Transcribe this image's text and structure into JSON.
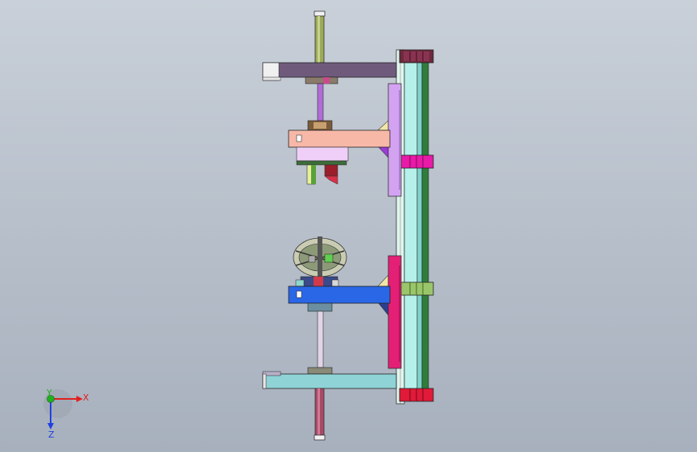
{
  "viewport": {
    "background_top": "#c9d0d9",
    "background_bottom": "#a7b0bd"
  },
  "triad": {
    "x_label": "X",
    "y_label": "Y",
    "z_label": "Z",
    "x_color": "#e02020",
    "y_color": "#20b020",
    "z_color": "#2040e0"
  },
  "model": {
    "parts": [
      "top-rod",
      "top-arm",
      "upper-spindle",
      "upper-arm",
      "upper-gripper",
      "rotary-table",
      "lower-arm",
      "lower-spindle",
      "bottom-arm",
      "bottom-rod",
      "main-column",
      "upper-slide-plate",
      "lower-slide-plate",
      "column-clamps"
    ],
    "colors": {
      "top_arm": "#6f5a7c",
      "upper_arm": "#f7b8a8",
      "lower_arm": "#2a67e6",
      "bottom_arm": "#8fd3d6",
      "column_face": "#b5f0ea",
      "column_edge": "#2f7d3c",
      "upper_plate": "#d3a3f2",
      "lower_plate": "#e41f76",
      "rod_top": "#9bab5a",
      "rod_bottom": "#a84a66"
    }
  }
}
